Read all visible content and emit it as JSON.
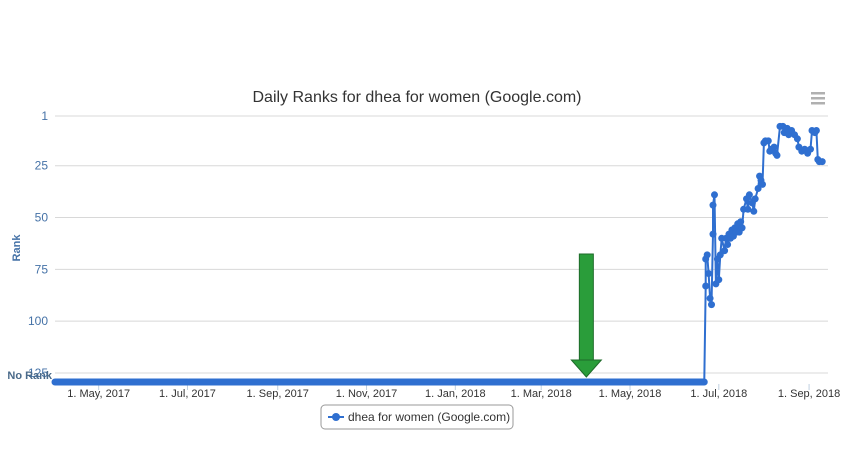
{
  "chart_data": {
    "type": "line",
    "title": "Daily Ranks for dhea for women (Google.com)",
    "ylabel": "Rank",
    "y_reversed": true,
    "ylim": [
      1,
      125
    ],
    "y_ticks": [
      "1",
      "25",
      "50",
      "75",
      "100",
      "125"
    ],
    "no_rank_label": "No Rank",
    "x_ticks": [
      "1. May, 2017",
      "1. Jul, 2017",
      "1. Sep, 2017",
      "1. Nov, 2017",
      "1. Jan, 2018",
      "1. Mar, 2018",
      "1. May, 2018",
      "1. Jul, 2018",
      "1. Sep, 2018"
    ],
    "legend": "dhea for women (Google.com)",
    "series": [
      {
        "name": "dhea for women (Google.com)",
        "color": "#2f6fd0",
        "no_rank_ranges": [
          [
            "2017-04-01",
            "2017-07-01"
          ],
          [
            "2017-07-02",
            "2018-06-21"
          ]
        ],
        "points": [
          [
            "2018-06-22",
            83
          ],
          [
            "2018-06-22",
            70
          ],
          [
            "2018-06-23",
            68
          ],
          [
            "2018-06-24",
            77
          ],
          [
            "2018-06-25",
            89
          ],
          [
            "2018-06-26",
            92
          ],
          [
            "2018-06-27",
            58
          ],
          [
            "2018-06-27",
            44
          ],
          [
            "2018-06-28",
            39
          ],
          [
            "2018-06-29",
            82
          ],
          [
            "2018-06-30",
            70
          ],
          [
            "2018-07-01",
            80
          ],
          [
            "2018-07-02",
            68
          ],
          [
            "2018-07-03",
            60
          ],
          [
            "2018-07-05",
            66
          ],
          [
            "2018-07-06",
            60
          ],
          [
            "2018-07-07",
            63
          ],
          [
            "2018-07-08",
            58
          ],
          [
            "2018-07-09",
            60
          ],
          [
            "2018-07-10",
            56
          ],
          [
            "2018-07-11",
            59
          ],
          [
            "2018-07-12",
            55
          ],
          [
            "2018-07-13",
            57
          ],
          [
            "2018-07-14",
            53
          ],
          [
            "2018-07-15",
            57
          ],
          [
            "2018-07-16",
            52
          ],
          [
            "2018-07-17",
            55
          ],
          [
            "2018-07-18",
            46
          ],
          [
            "2018-07-20",
            41
          ],
          [
            "2018-07-21",
            46
          ],
          [
            "2018-07-22",
            39
          ],
          [
            "2018-07-24",
            43
          ],
          [
            "2018-07-25",
            47
          ],
          [
            "2018-07-26",
            41
          ],
          [
            "2018-07-28",
            36
          ],
          [
            "2018-07-29",
            30
          ],
          [
            "2018-07-30",
            32
          ],
          [
            "2018-07-31",
            34
          ],
          [
            "2018-08-01",
            14
          ],
          [
            "2018-08-02",
            13
          ],
          [
            "2018-08-04",
            13
          ],
          [
            "2018-08-05",
            18
          ],
          [
            "2018-08-06",
            17
          ],
          [
            "2018-08-08",
            16
          ],
          [
            "2018-08-09",
            19
          ],
          [
            "2018-08-10",
            20
          ],
          [
            "2018-08-12",
            6
          ],
          [
            "2018-08-14",
            6
          ],
          [
            "2018-08-15",
            9
          ],
          [
            "2018-08-17",
            7
          ],
          [
            "2018-08-18",
            10
          ],
          [
            "2018-08-20",
            8
          ],
          [
            "2018-08-22",
            10
          ],
          [
            "2018-08-24",
            12
          ],
          [
            "2018-08-25",
            16
          ],
          [
            "2018-08-27",
            18
          ],
          [
            "2018-08-29",
            17
          ],
          [
            "2018-08-31",
            19
          ],
          [
            "2018-09-02",
            17
          ],
          [
            "2018-09-03",
            8
          ],
          [
            "2018-09-05",
            9
          ],
          [
            "2018-09-06",
            8
          ],
          [
            "2018-09-07",
            22
          ],
          [
            "2018-09-08",
            23
          ],
          [
            "2018-09-10",
            23
          ]
        ]
      }
    ],
    "annotation": {
      "type": "arrow",
      "color": "#2a9d3a",
      "x_date": "2018-04-01"
    }
  }
}
